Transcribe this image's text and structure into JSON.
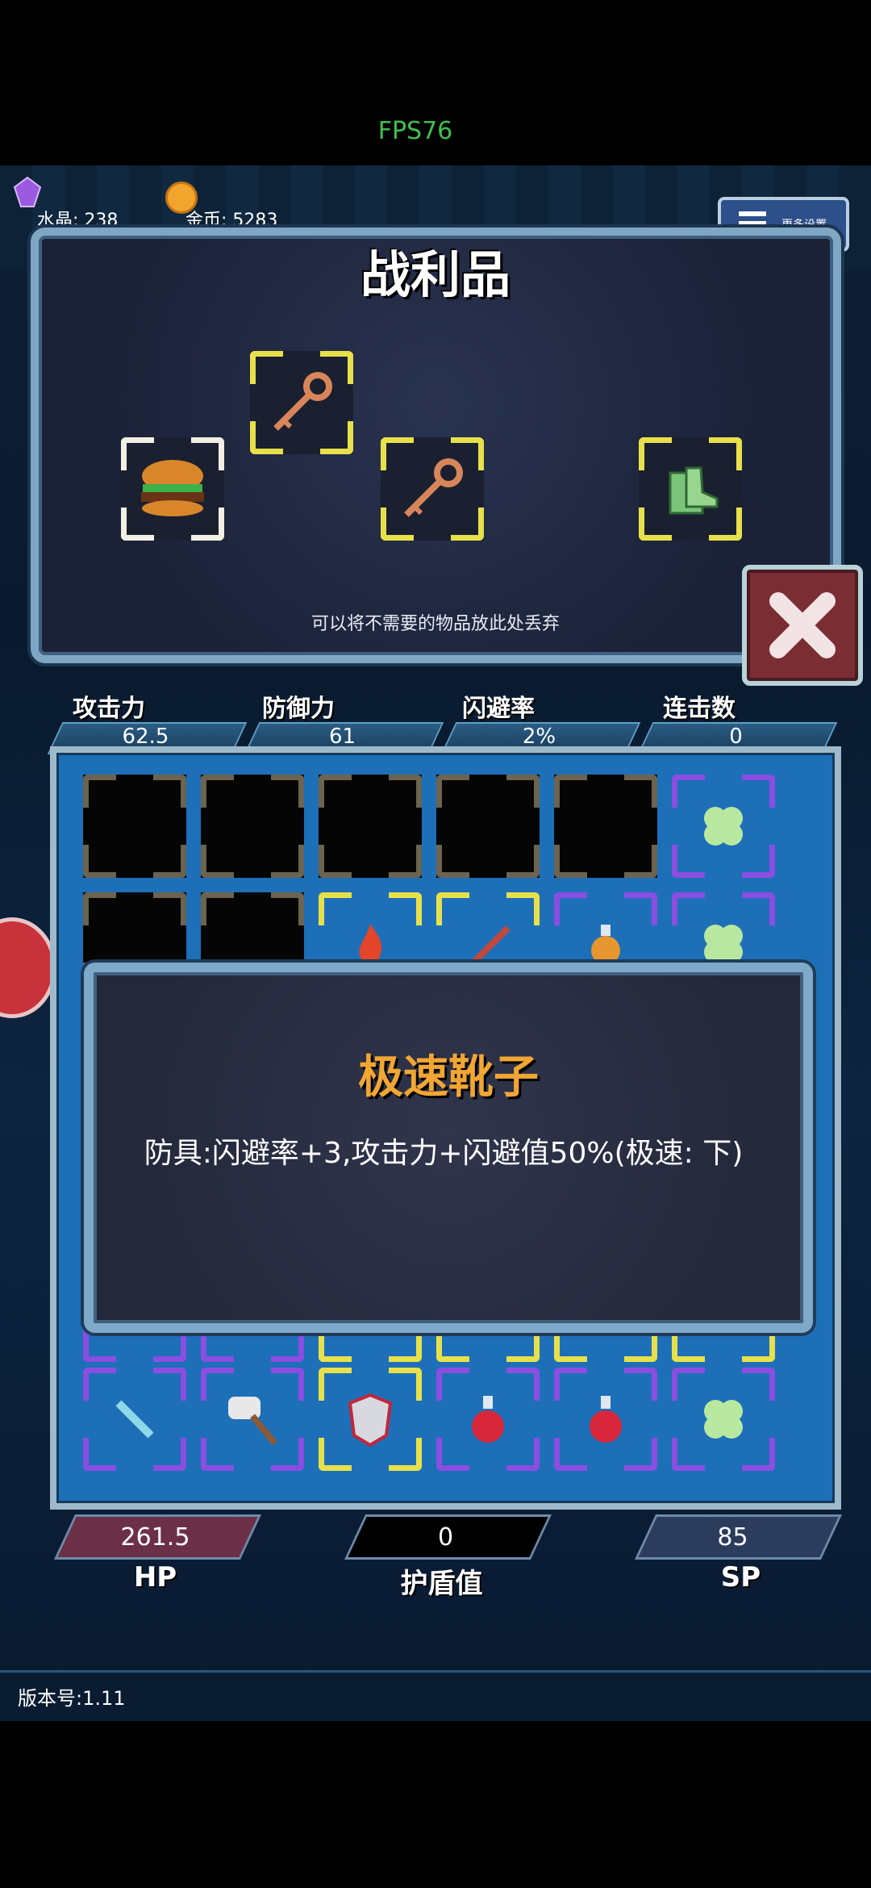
{
  "fps": "FPS76",
  "resources": {
    "crystal_label": "水晶: 238",
    "gold_label": "金币: 5283",
    "settings_label": "更多设置"
  },
  "loot": {
    "title": "战利品",
    "discard_hint": "可以将不需要的物品放此处丢弃",
    "items": [
      {
        "name": "hamburger-icon",
        "frame": "white"
      },
      {
        "name": "bronze-key-icon",
        "frame": "yellow"
      },
      {
        "name": "bronze-key-icon",
        "frame": "yellow"
      },
      {
        "name": "speed-boots-icon",
        "frame": "yellow"
      }
    ]
  },
  "stats": [
    {
      "label": "攻击力",
      "value": "62.5"
    },
    {
      "label": "防御力",
      "value": "61"
    },
    {
      "label": "闪避率",
      "value": "2%"
    },
    {
      "label": "连击数",
      "value": "0"
    }
  ],
  "tooltip": {
    "title": "极速靴子",
    "description": "防具:闪避率+3,攻击力+闪避值50%(极速: 下)"
  },
  "bottom_bars": {
    "hp_value": "261.5",
    "hp_label": "HP",
    "shield_value": "0",
    "shield_label": "护盾值",
    "sp_value": "85",
    "sp_label": "SP"
  },
  "version": "版本号:1.11",
  "colors": {
    "accent_orange": "#f1a634",
    "fps_green": "#3fbf4f",
    "frame_yellow": "#e8e04a",
    "frame_purple": "#8a4ee0"
  }
}
